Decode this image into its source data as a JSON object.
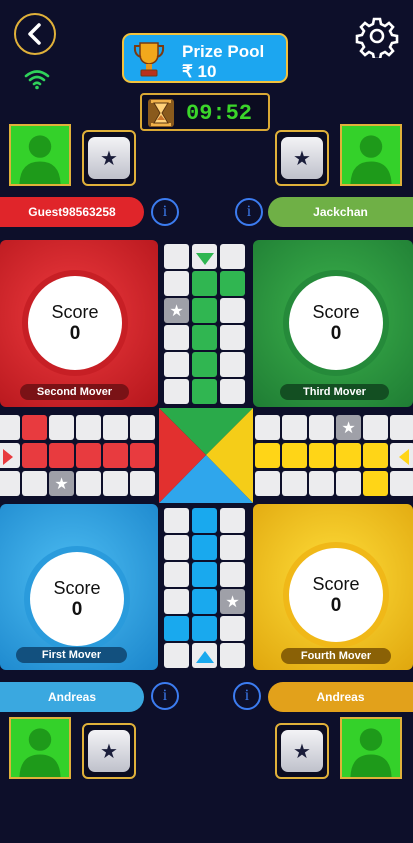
{
  "prize": {
    "label": "Prize Pool",
    "amount": "₹ 10"
  },
  "timer": {
    "time": "09:52"
  },
  "players": {
    "top_left": {
      "name": "Guest98563258"
    },
    "top_right": {
      "name": "Jackchan"
    },
    "bottom_left": {
      "name": "Andreas"
    },
    "bottom_right": {
      "name": "Andreas"
    }
  },
  "homes": {
    "red": {
      "score_label": "Score",
      "score": "0",
      "mover": "Second Mover",
      "color": "#e0252a"
    },
    "green": {
      "score_label": "Score",
      "score": "0",
      "mover": "Third Mover",
      "color": "#2b9b44"
    },
    "blue": {
      "score_label": "Score",
      "score": "0",
      "mover": "First Mover",
      "color": "#2a9fe3"
    },
    "yellow": {
      "score_label": "Score",
      "score": "0",
      "mover": "Fourth Mover",
      "color": "#f5c417"
    }
  },
  "info_label": "i",
  "colors": {
    "accent_gold": "#e0b13a",
    "background": "#0d0f2a",
    "timer_green": "#3bd62a",
    "prize_blue": "#1ca6f0"
  },
  "icons": [
    "back-arrow-icon",
    "gear-icon",
    "wifi-icon",
    "trophy-icon",
    "hourglass-icon",
    "star-icon",
    "info-icon",
    "avatar-icon"
  ]
}
